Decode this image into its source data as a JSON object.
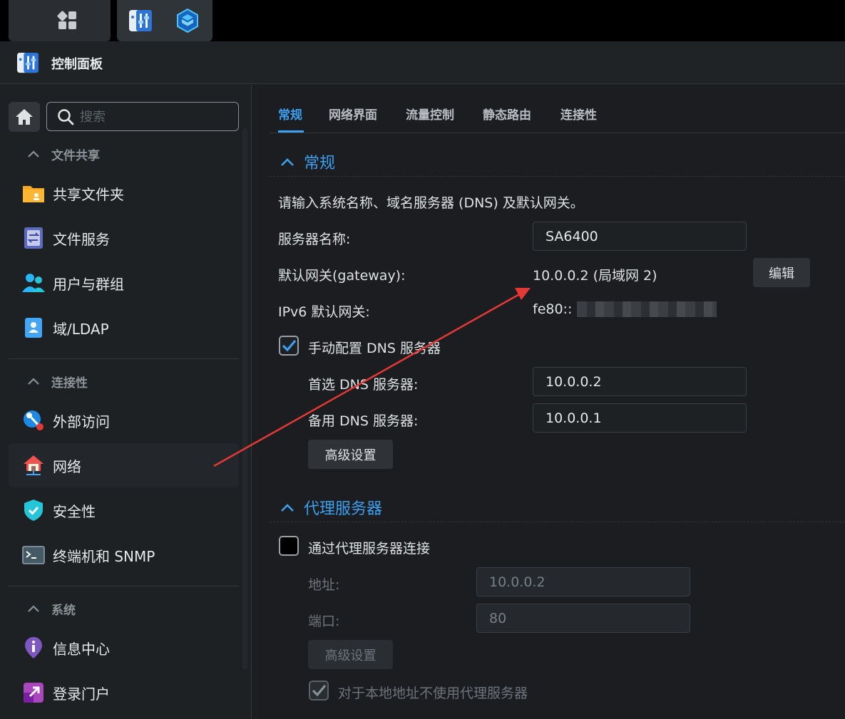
{
  "window": {
    "title": "控制面板"
  },
  "sidebar": {
    "search_placeholder": "搜索",
    "groups": [
      {
        "label": "文件共享",
        "items": [
          "共享文件夹",
          "文件服务",
          "用户与群组",
          "域/LDAP"
        ]
      },
      {
        "label": "连接性",
        "items": [
          "外部访问",
          "网络",
          "安全性",
          "终端机和 SNMP"
        ]
      },
      {
        "label": "系统",
        "items": [
          "信息中心",
          "登录门户"
        ]
      }
    ],
    "active_item": "网络"
  },
  "tabs": [
    "常规",
    "网络界面",
    "流量控制",
    "静态路由",
    "连接性"
  ],
  "active_tab": "常规",
  "general": {
    "header": "常规",
    "description": "请输入系统名称、域名服务器 (DNS) 及默认网关。",
    "server_name_label": "服务器名称:",
    "server_name_value": "SA6400",
    "gateway_label": "默认网关(gateway):",
    "gateway_value": "10.0.0.2 (局域网 2)",
    "edit_label": "编辑",
    "ipv6_label": "IPv6 默认网关:",
    "ipv6_value": "fe80::",
    "manual_dns_label": "手动配置 DNS 服务器",
    "manual_dns_checked": true,
    "primary_dns_label": "首选 DNS 服务器:",
    "primary_dns_value": "10.0.0.2",
    "secondary_dns_label": "备用 DNS 服务器:",
    "secondary_dns_value": "10.0.0.1",
    "advanced_label": "高级设置"
  },
  "proxy": {
    "header": "代理服务器",
    "connect_label": "通过代理服务器连接",
    "connect_checked": false,
    "address_label": "地址:",
    "address_value": "10.0.0.2",
    "port_label": "端口:",
    "port_value": "80",
    "advanced_label": "高级设置",
    "bypass_label": "对于本地地址不使用代理服务器",
    "bypass_checked": true
  },
  "colors": {
    "accent": "#3ca0f0",
    "annotation": "#e53935"
  }
}
